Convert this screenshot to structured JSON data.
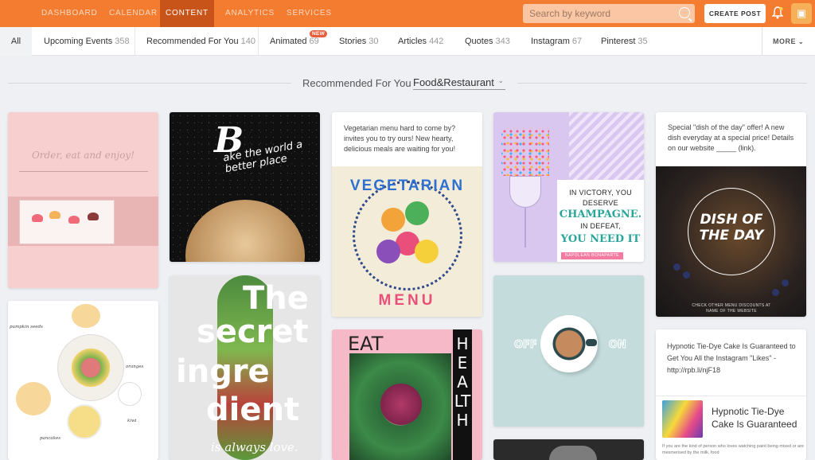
{
  "nav": {
    "items": [
      "DASHBOARD",
      "CALENDAR",
      "CONTENT",
      "ANALYTICS",
      "SERVICES"
    ],
    "active": "CONTENT",
    "search_placeholder": "Search by keyword",
    "create_post": "CREATE POST"
  },
  "filters": {
    "all": "All",
    "tabs": [
      {
        "label": "Upcoming Events",
        "count": "358"
      },
      {
        "label": "Recommended For You",
        "count": "140"
      },
      {
        "label": "Animated",
        "count": "69"
      },
      {
        "label": "Stories",
        "count": "30"
      },
      {
        "label": "Articles",
        "count": "442"
      },
      {
        "label": "Quotes",
        "count": "343"
      },
      {
        "label": "Instagram",
        "count": "67"
      },
      {
        "label": "Pinterest",
        "count": "35"
      }
    ],
    "new_badge": "NEW",
    "more": "MORE"
  },
  "section": {
    "title": "Recommended For You",
    "category": "Food&Restaurant"
  },
  "cards": {
    "order_script": "Order, eat and enjoy!",
    "bread_b": "B",
    "bread_text": "ake the world a better place",
    "vegetarian_caption": "Vegetarian menu hard to come by? invites you to try ours! New hearty, delicious meals are waiting for you!",
    "vegetarian_top": "VEGETARIAN",
    "vegetarian_bottom": "MENU",
    "champ_l1": "IN VICTORY, YOU DESERVE",
    "champ_l2": "CHAMPAGNE.",
    "champ_l3": "IN DEFEAT,",
    "champ_l4": "YOU NEED IT",
    "champ_tag": "NAPOLEAN BONAPARTE",
    "dish_caption": "Special \"dish of the day\" offer! A new dish everyday at a special price! Details on our website _____ (link).",
    "dish_title": "DISH OF THE DAY",
    "dish_footer": "CHECK OTHER MENU DISCOUNTS AT NAME OF THE WEBSITE",
    "topview_labels": [
      "pumpkin seeds",
      "oranges",
      "kiwi",
      "pancakes"
    ],
    "secret_lines": [
      "The",
      "secret",
      "ingre",
      "dient"
    ],
    "secret_tag": "is always love.",
    "eat": "EAT",
    "health": "HEALTH",
    "off": "OFF",
    "on": "ON",
    "tiedye_caption": "Hypnotic Tie-Dye Cake Is Guaranteed to Get You All the Instagram \"Likes\" - http://rpb.li/njF18",
    "tiedye_title": "Hypnotic Tie-Dye Cake Is Guaranteed",
    "tiedye_small": "If you are the kind of person who loves watching paint being mixed or are mesmerised by the milk, food"
  },
  "colors": {
    "nav_bg": "#f47c30",
    "nav_active": "#c8541a",
    "page_bg": "#eef0f3"
  }
}
